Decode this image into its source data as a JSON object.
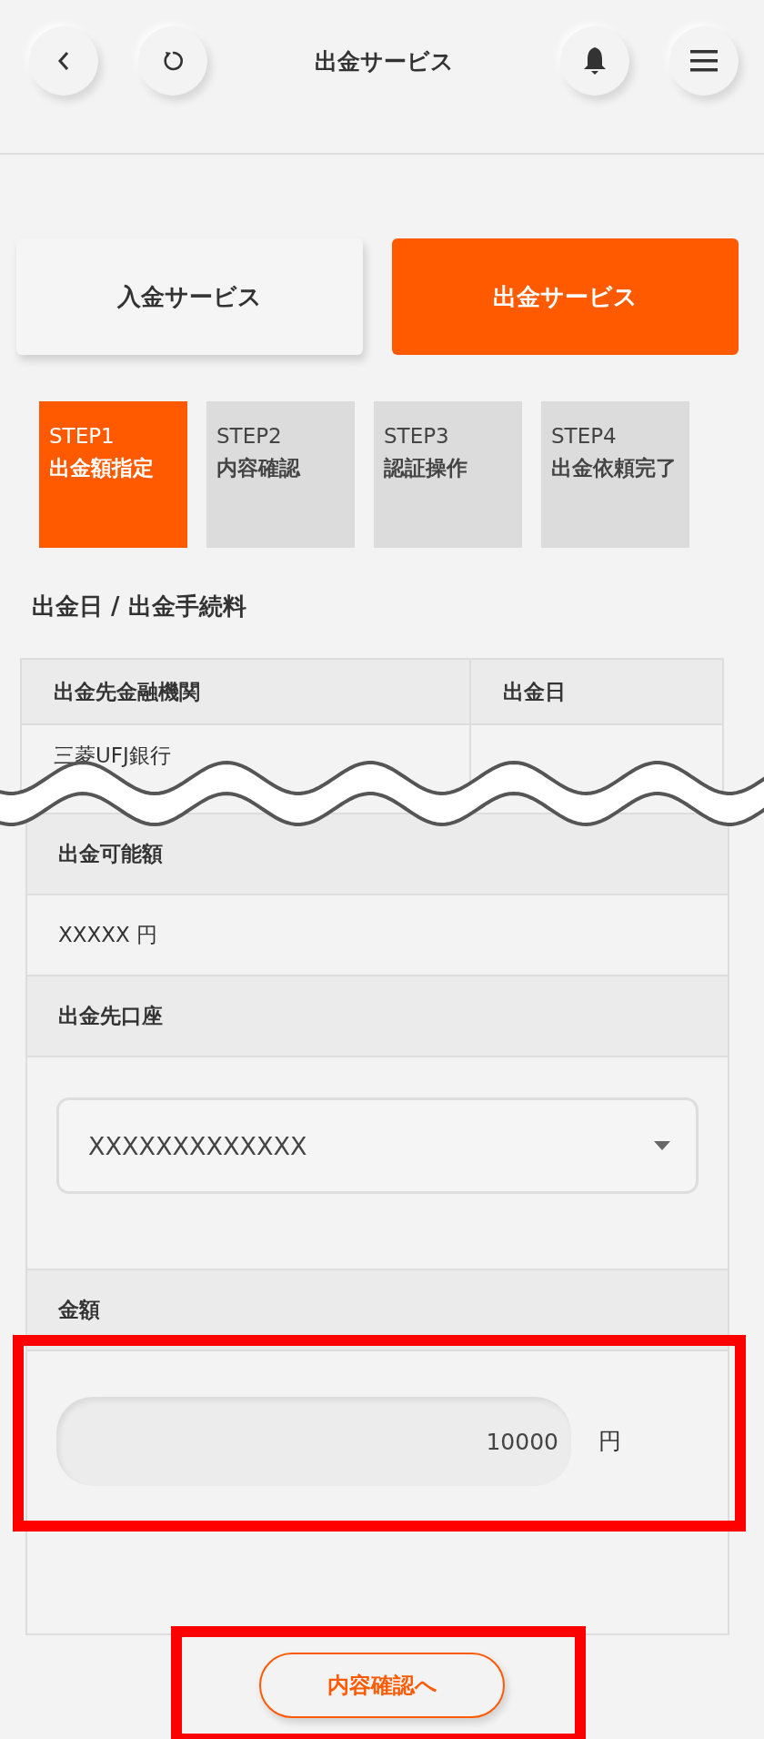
{
  "header": {
    "title": "出金サービス"
  },
  "service_tabs": [
    {
      "label": "入金サービス",
      "selected": false
    },
    {
      "label": "出金サービス",
      "selected": true
    }
  ],
  "steps": [
    {
      "step": "STEP1",
      "label": "出金額指定",
      "selected": true
    },
    {
      "step": "STEP2",
      "label": "内容確認",
      "selected": false
    },
    {
      "step": "STEP3",
      "label": "認証操作",
      "selected": false
    },
    {
      "step": "STEP4",
      "label": "出金依頼完了",
      "selected": false
    }
  ],
  "section_title": "出金日 / 出金手続料",
  "schedule_table": {
    "columns": [
      "出金先金融機関",
      "出金日"
    ],
    "rows": [
      {
        "bank": "三菱UFJ銀行"
      }
    ]
  },
  "form": {
    "available_label": "出金可能額",
    "available_value": "XXXXX 円",
    "account_label": "出金先口座",
    "account_value": "XXXXXXXXXXXXX",
    "amount_label": "金額",
    "amount_value": "10000",
    "amount_unit": "円"
  },
  "next_button": "内容確認へ"
}
